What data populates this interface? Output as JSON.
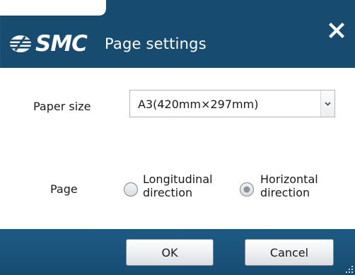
{
  "window": {
    "brand": "SMC",
    "title": "Page settings",
    "close_icon": "close-x-icon"
  },
  "form": {
    "paper_size_label": "Paper size",
    "paper_size_value": "A3(420mm×297mm)",
    "page_label": "Page",
    "orientation_options": [
      {
        "line1": "Longitudinal",
        "line2": "direction",
        "selected": false
      },
      {
        "line1": "Horizontal",
        "line2": "direction",
        "selected": true
      }
    ]
  },
  "buttons": {
    "ok_label": "OK",
    "cancel_label": "Cancel"
  },
  "colors": {
    "header": "#174b70",
    "footer": "#174c72"
  }
}
